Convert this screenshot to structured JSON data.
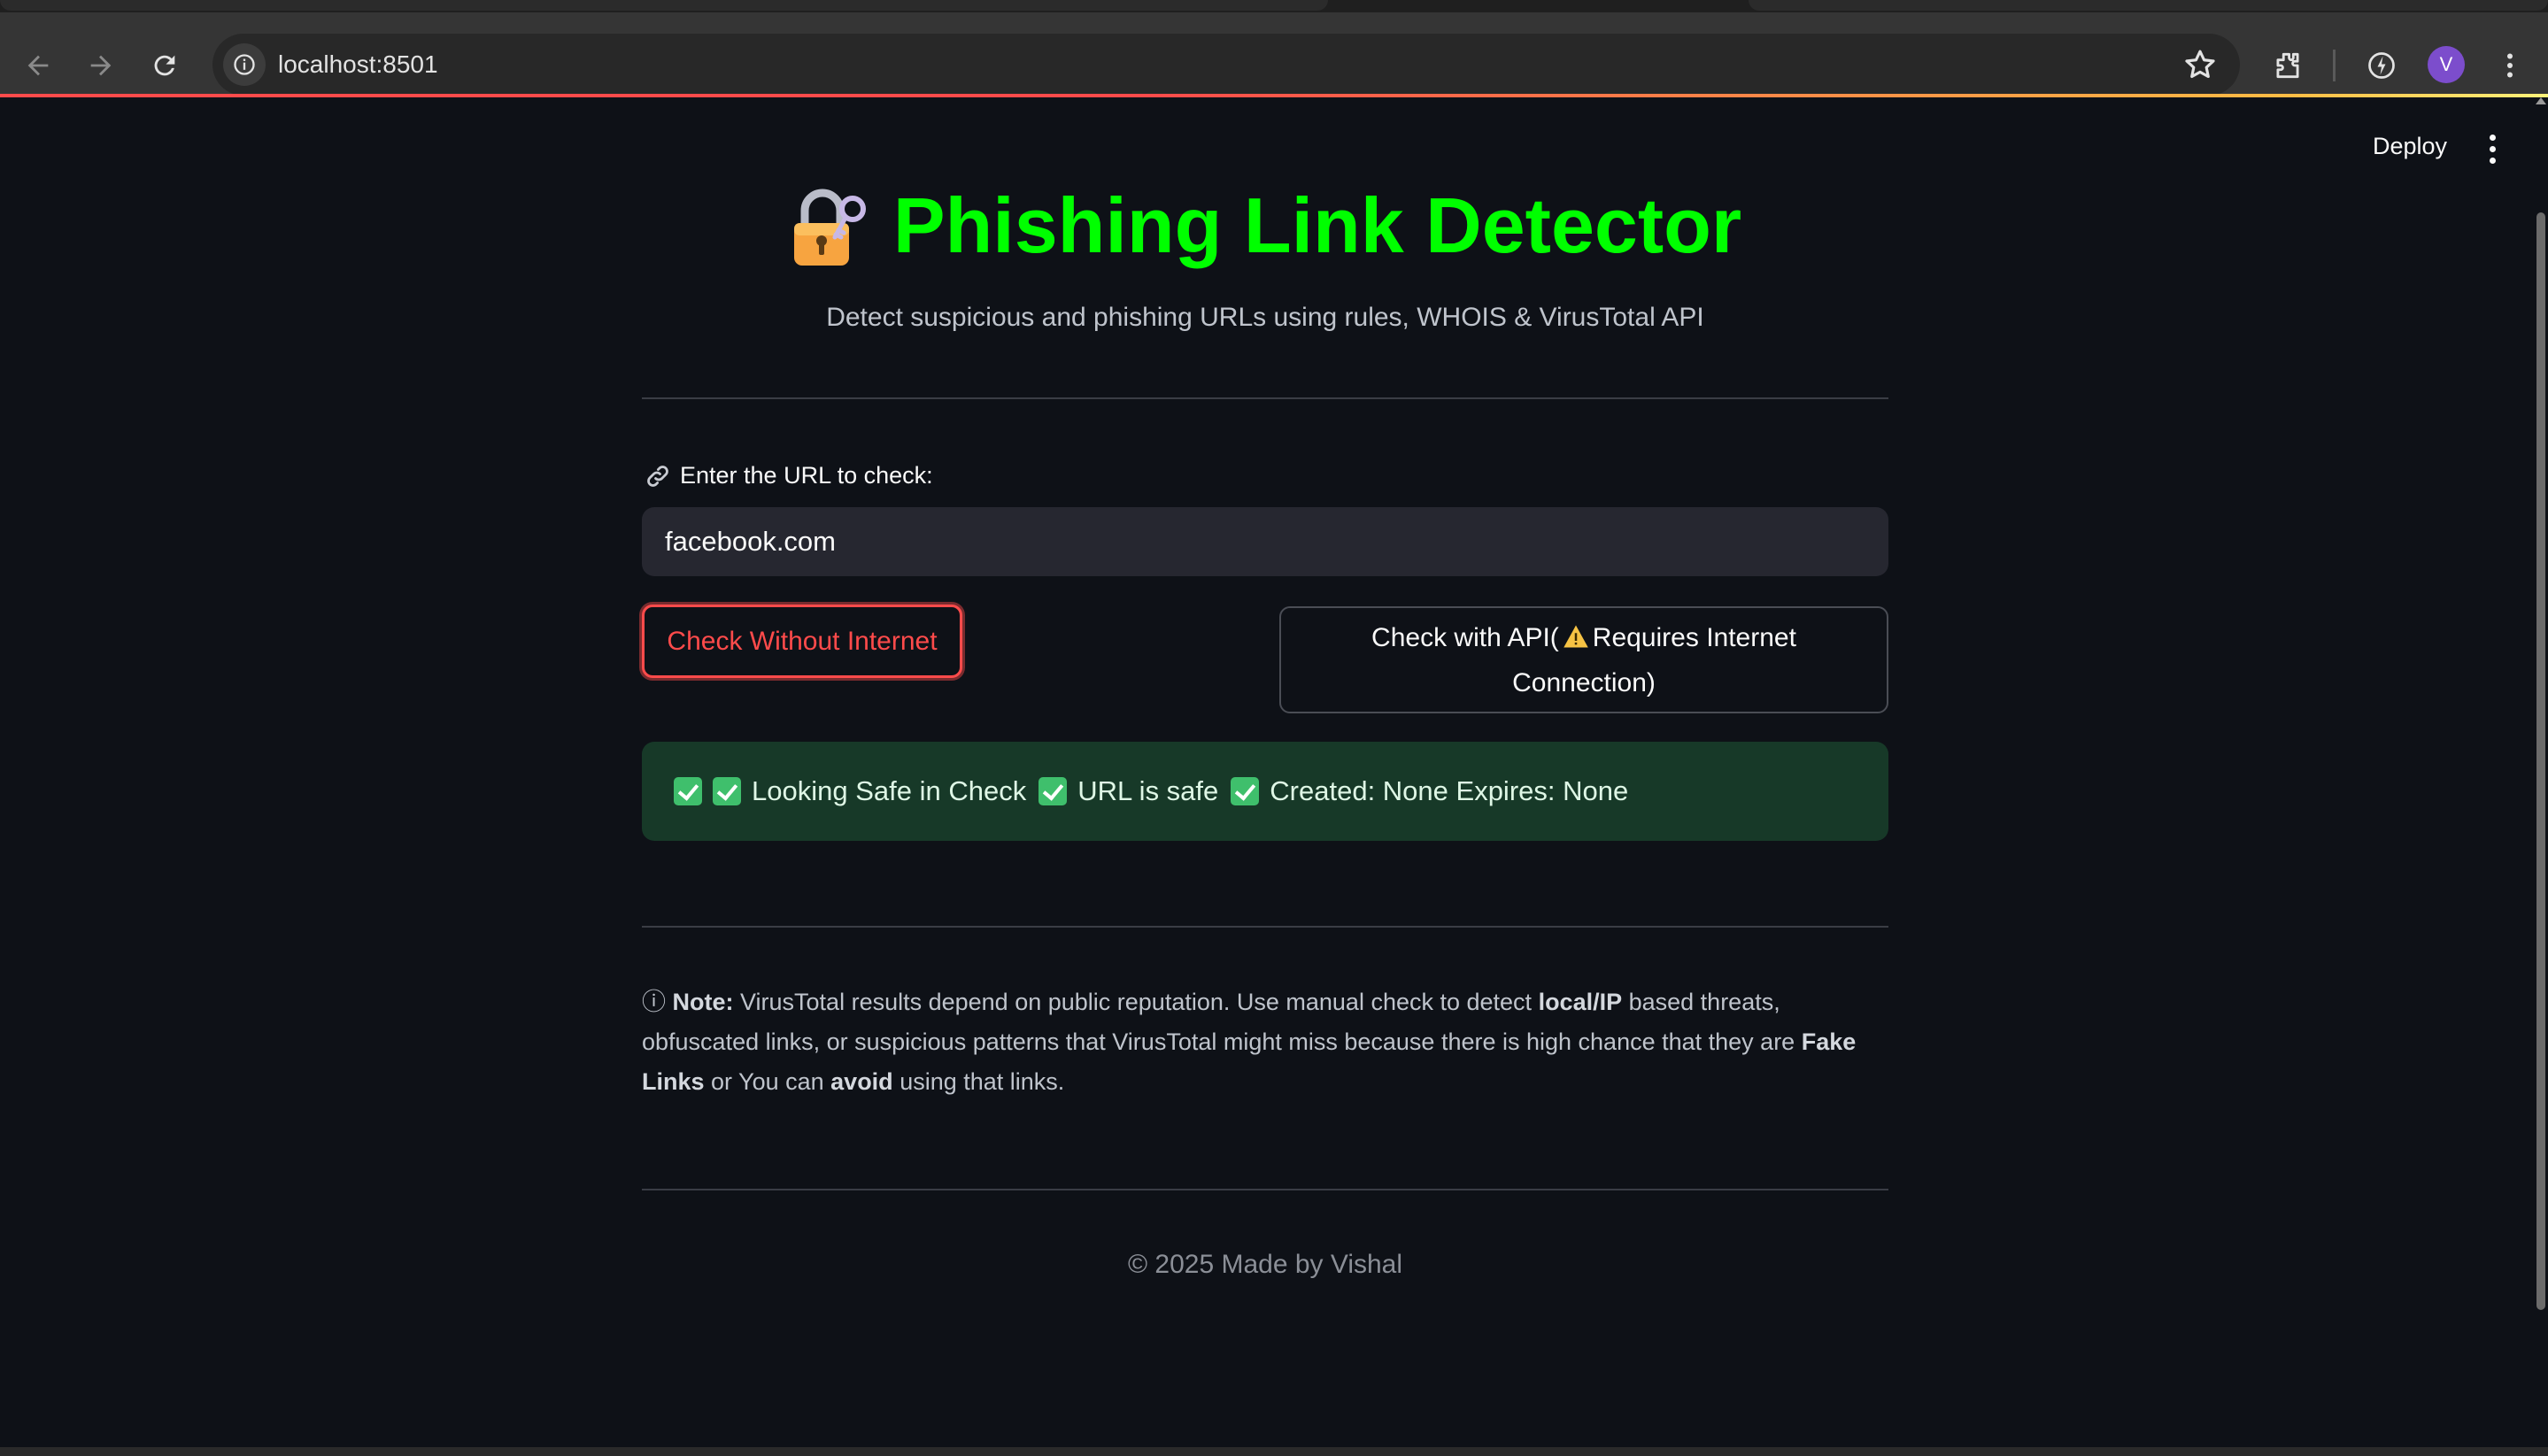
{
  "browser": {
    "url": "localhost:8501",
    "profile_initial": "V"
  },
  "header": {
    "deploy_label": "Deploy"
  },
  "main": {
    "title": "Phishing Link Detector",
    "title_icon": "locked-with-key-icon",
    "subtitle": "Detect suspicious and phishing URLs using rules, WHOIS & VirusTotal API",
    "url_label": "Enter the URL to check:",
    "url_label_icon": "link-icon",
    "url_value": "facebook.com",
    "btn_offline": "Check Without Internet",
    "btn_api_pre": "Check with API(",
    "btn_api_post": "Requires Internet Connection)",
    "btn_api_icon": "warning-icon",
    "result": {
      "items": [
        "Looking Safe in Check",
        "URL is safe",
        "Created: None Expires: None"
      ],
      "icon": "check-mark-button-icon",
      "status_color": "#173928"
    },
    "note": {
      "prefix": "ⓘ",
      "label": "Note:",
      "part1": " VirusTotal results depend on public reputation. Use manual check to detect ",
      "bold1": "local/IP",
      "part2": " based threats, obfuscated links, or suspicious patterns that VirusTotal might miss because there is high chance that they are ",
      "bold2": "Fake Links",
      "part3": " or You can ",
      "bold3": "avoid",
      "part4": " using that links."
    },
    "footer": "© 2025 Made by Vishal"
  },
  "colors": {
    "title": "#00ff00",
    "primary": "#ff4b4b",
    "background": "#0e1117",
    "success_bg": "#173928"
  }
}
